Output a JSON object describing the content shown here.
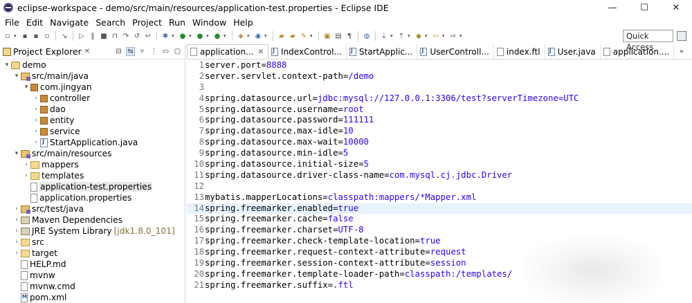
{
  "window": {
    "title": "eclipse-workspace - demo/src/main/resources/application-test.properties - Eclipse IDE",
    "minimize": "—",
    "maximize": "☐",
    "close": "✕"
  },
  "menu": [
    "File",
    "Edit",
    "Navigate",
    "Search",
    "Project",
    "Run",
    "Window",
    "Help"
  ],
  "toolbar": {
    "quick_access": "Quick Access"
  },
  "explorer": {
    "title": "Project Explorer",
    "close": "✕",
    "tree": [
      {
        "label": "demo",
        "twisty": "▾",
        "depth": 0,
        "icon": "project"
      },
      {
        "label": "src/main/java",
        "twisty": "▾",
        "depth": 1,
        "icon": "srcfolder"
      },
      {
        "label": "com.jingyan",
        "twisty": "▾",
        "depth": 2,
        "icon": "package"
      },
      {
        "label": "controller",
        "twisty": "›",
        "depth": 3,
        "icon": "package"
      },
      {
        "label": "dao",
        "twisty": "›",
        "depth": 3,
        "icon": "package"
      },
      {
        "label": "entity",
        "twisty": "›",
        "depth": 3,
        "icon": "package"
      },
      {
        "label": "service",
        "twisty": "›",
        "depth": 3,
        "icon": "package"
      },
      {
        "label": "StartApplication.java",
        "twisty": "›",
        "depth": 3,
        "icon": "java"
      },
      {
        "label": "src/main/resources",
        "twisty": "▾",
        "depth": 1,
        "icon": "srcfolder"
      },
      {
        "label": "mappers",
        "twisty": "›",
        "depth": 2,
        "icon": "folder"
      },
      {
        "label": "templates",
        "twisty": "›",
        "depth": 2,
        "icon": "folder"
      },
      {
        "label": "application-test.properties",
        "twisty": "",
        "depth": 2,
        "icon": "file",
        "selected": true
      },
      {
        "label": "application.properties",
        "twisty": "",
        "depth": 2,
        "icon": "file"
      },
      {
        "label": "src/test/java",
        "twisty": "›",
        "depth": 1,
        "icon": "srcfolder"
      },
      {
        "label": "Maven Dependencies",
        "twisty": "›",
        "depth": 1,
        "icon": "lib"
      },
      {
        "label": "JRE System Library",
        "suffix": "[jdk1.8.0_101]",
        "twisty": "›",
        "depth": 1,
        "icon": "lib"
      },
      {
        "label": "src",
        "twisty": "›",
        "depth": 1,
        "icon": "folder"
      },
      {
        "label": "target",
        "twisty": "›",
        "depth": 1,
        "icon": "folder"
      },
      {
        "label": "HELP.md",
        "twisty": "",
        "depth": 1,
        "icon": "file"
      },
      {
        "label": "mvnw",
        "twisty": "",
        "depth": 1,
        "icon": "file"
      },
      {
        "label": "mvnw.cmd",
        "twisty": "",
        "depth": 1,
        "icon": "file"
      },
      {
        "label": "pom.xml",
        "twisty": "",
        "depth": 1,
        "icon": "xml"
      }
    ]
  },
  "tabs": [
    {
      "label": "application...",
      "icon": "file",
      "active": true,
      "close": "✕"
    },
    {
      "label": "IndexControl...",
      "icon": "java"
    },
    {
      "label": "StartApplic...",
      "icon": "java"
    },
    {
      "label": "UserControll...",
      "icon": "java"
    },
    {
      "label": "index.ftl",
      "icon": "file"
    },
    {
      "label": "User.java",
      "icon": "java"
    },
    {
      "label": "application....",
      "icon": "file"
    }
  ],
  "tab_overflow": "»",
  "code": [
    {
      "n": "1",
      "key": "server.port",
      "val": "8888"
    },
    {
      "n": "2",
      "key": "server.servlet.context-path",
      "val": "/demo"
    },
    {
      "n": "3",
      "key": "",
      "val": ""
    },
    {
      "n": "4",
      "key": "spring.datasource.url",
      "val": "jdbc:mysql://127.0.0.1:3306/test?serverTimezone=UTC"
    },
    {
      "n": "5",
      "key": "spring.datasource.username",
      "val": "root"
    },
    {
      "n": "6",
      "key": "spring.datasource.password",
      "val": "111111"
    },
    {
      "n": "7",
      "key": "spring.datasource.max-idle",
      "val": "10"
    },
    {
      "n": "8",
      "key": "spring.datasource.max-wait",
      "val": "10000"
    },
    {
      "n": "9",
      "key": "spring.datasource.min-idle",
      "val": "5"
    },
    {
      "n": "10",
      "key": "spring.datasource.initial-size",
      "val": "5"
    },
    {
      "n": "11",
      "key": "spring.datasource.driver-class-name",
      "val": "com.mysql.cj.jdbc.Driver"
    },
    {
      "n": "12",
      "key": "",
      "val": ""
    },
    {
      "n": "13",
      "key": "mybatis.mapperLocations",
      "val": "classpath:mappers/*Mapper.xml"
    },
    {
      "n": "14",
      "key": "spring.freemarker.enabled",
      "val": "true",
      "current": true
    },
    {
      "n": "15",
      "key": "spring.freemarker.cache",
      "val": "false"
    },
    {
      "n": "16",
      "key": "spring.freemarker.charset",
      "val": "UTF-8"
    },
    {
      "n": "17",
      "key": "spring.freemarker.check-template-location",
      "val": "true"
    },
    {
      "n": "18",
      "key": "spring.freemarker.request-context-attribute",
      "val": "request"
    },
    {
      "n": "19",
      "key": "spring.freemarker.session-context-attribute",
      "val": "session"
    },
    {
      "n": "20",
      "key": "spring.freemarker.template-loader-path",
      "val": "classpath:/templates/"
    },
    {
      "n": "21",
      "key": "spring.freemarker.suffix",
      "val": ".ftl"
    }
  ],
  "colors": {
    "value": "#2a00ff",
    "line_number": "#787878",
    "current_line": "#e8f2fe"
  }
}
